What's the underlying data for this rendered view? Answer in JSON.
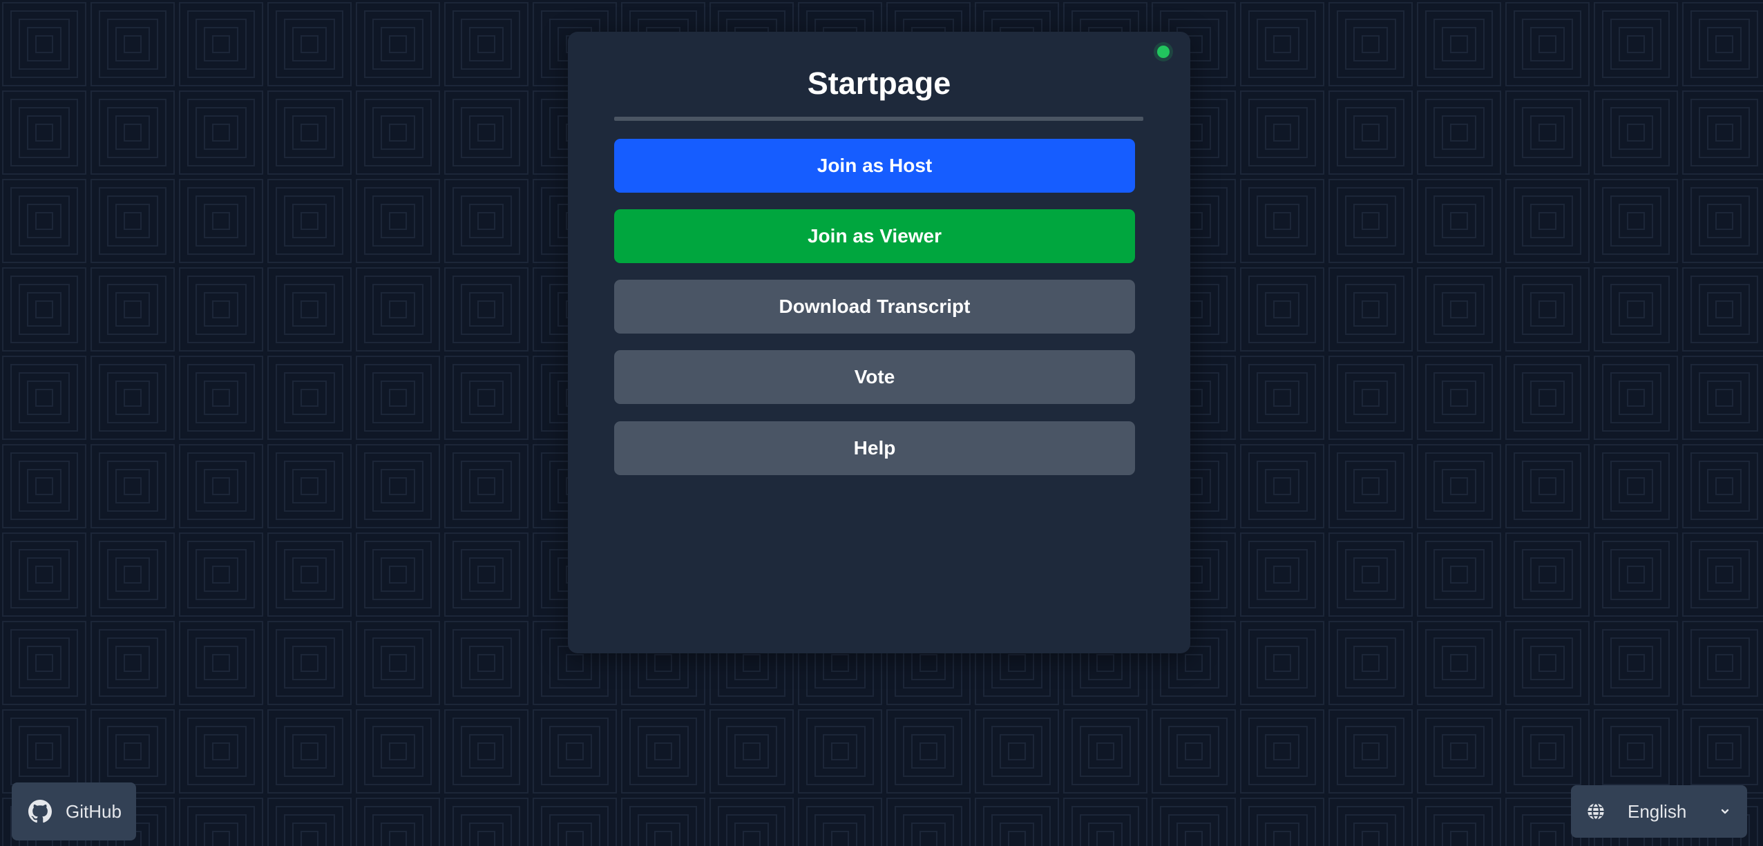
{
  "card": {
    "title": "Startpage",
    "status_color": "#22c55e"
  },
  "buttons": {
    "host": {
      "label": "Join as Host",
      "color": "#165dff"
    },
    "viewer": {
      "label": "Join as Viewer",
      "color": "#00a63e"
    },
    "transcript": {
      "label": "Download Transcript",
      "color": "#4a5565"
    },
    "vote": {
      "label": "Vote",
      "color": "#4a5565"
    },
    "help": {
      "label": "Help",
      "color": "#4a5565"
    }
  },
  "footer": {
    "github_label": "GitHub",
    "language": {
      "selected": "English"
    }
  },
  "icons": {
    "github": "github-icon",
    "globe": "globe-icon",
    "chevron": "chevron-down-icon",
    "status": "status-dot"
  }
}
